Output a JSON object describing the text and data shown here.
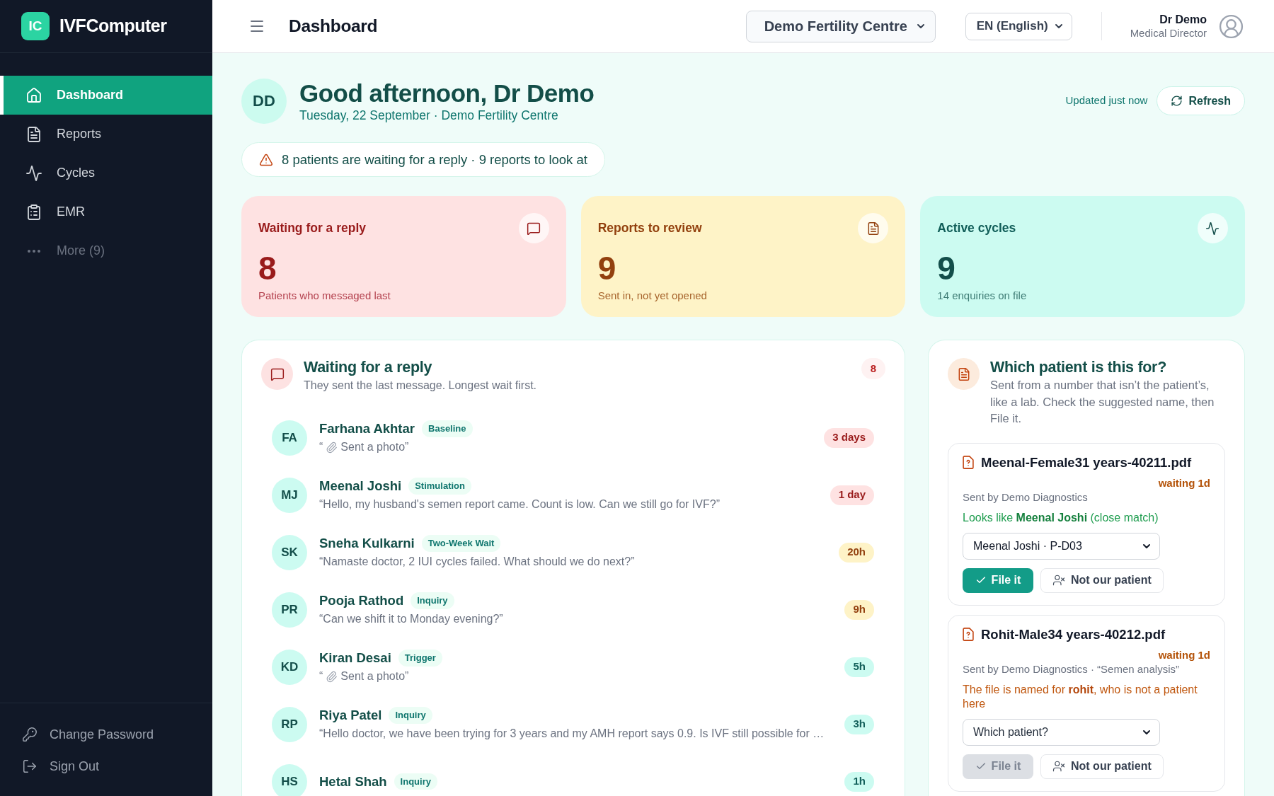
{
  "sidebar": {
    "logo_mark": "IC",
    "brand": "IVFComputer",
    "items": [
      {
        "label": "Dashboard",
        "kind": "page",
        "selected": true
      },
      {
        "label": "Reports",
        "kind": "page",
        "selected": false
      },
      {
        "label": "Cycles",
        "kind": "page",
        "selected": false
      },
      {
        "label": "EMR",
        "kind": "page",
        "selected": false
      },
      {
        "label": "More (9)",
        "kind": "more",
        "selected": false
      }
    ],
    "footer_items": [
      {
        "label": "Change Password"
      },
      {
        "label": "Sign Out"
      }
    ]
  },
  "header": {
    "title": "Dashboard",
    "centre_select": {
      "value": "Demo Fertility Centre"
    },
    "language_select": {
      "value": "EN (English)"
    },
    "user": {
      "name": "Dr Demo",
      "role": "Medical Director"
    }
  },
  "greeting": {
    "initials": "DD",
    "title": "Good afternoon, Dr Demo",
    "subtitle": "Tuesday, 22 September · Demo Fertility Centre",
    "updated": "Updated just now",
    "refresh_button": "Refresh"
  },
  "alert": {
    "text": "8 patients are waiting for a reply · 9 reports to look at"
  },
  "stats": [
    {
      "title": "Waiting for a reply",
      "value": "8",
      "note": "Patients who messaged last",
      "color": "#fee2e2"
    },
    {
      "title": "Reports to review",
      "value": "9",
      "note": "Sent in, not yet opened",
      "color": "#fef3c7"
    },
    {
      "title": "Active cycles",
      "value": "9",
      "note": "14 enquiries on file",
      "color": "#ccfbf1"
    }
  ],
  "waiting": {
    "title": "Waiting for a reply",
    "subtitle": "They sent the last message. Longest wait first.",
    "count": "8",
    "rows": [
      {
        "initials": "FA",
        "name": "Farhana Akhtar",
        "stage": "Baseline",
        "kind": "photo",
        "quote_open": "“",
        "message": "Sent a photo”",
        "age": "3 days",
        "color": "#fee2e2"
      },
      {
        "initials": "MJ",
        "name": "Meenal Joshi",
        "stage": "Stimulation",
        "kind": "text",
        "message": "“Hello, my husband's semen report came. Count is low. Can we still go for IVF?”",
        "age": "1 day",
        "color": "#fee2e2"
      },
      {
        "initials": "SK",
        "name": "Sneha Kulkarni",
        "stage": "Two-Week Wait",
        "kind": "text",
        "message": "“Namaste doctor, 2 IUI cycles failed. What should we do next?”",
        "age": "20h",
        "color": "#fef3c7"
      },
      {
        "initials": "PR",
        "name": "Pooja Rathod",
        "stage": "Inquiry",
        "kind": "text",
        "message": "“Can we shift it to Monday evening?”",
        "age": "9h",
        "color": "#fef3c7"
      },
      {
        "initials": "KD",
        "name": "Kiran Desai",
        "stage": "Trigger",
        "kind": "photo",
        "quote_open": "“",
        "message": "Sent a photo”",
        "age": "5h",
        "color": "#ccfbf1"
      },
      {
        "initials": "RP",
        "name": "Riya Patel",
        "stage": "Inquiry",
        "kind": "text",
        "message": "“Hello doctor, we have been trying for 3 years and my AMH report says 0.9. Is IVF still possible for …",
        "age": "3h",
        "color": "#ccfbf1"
      },
      {
        "initials": "HS",
        "name": "Hetal Shah",
        "stage": "Inquiry",
        "kind": "text",
        "age": "1h",
        "color": "#ccfbf1"
      }
    ]
  },
  "reports": {
    "title": "Which patient is this for?",
    "description": "Sent from a number that isn’t the patient’s, like a lab. Check the suggested name, then File it.",
    "files": [
      {
        "filename": "Meenal-Female31 years-40211.pdf",
        "age": "waiting 1d",
        "sender": "Sent by Demo Diagnostics",
        "kind": "matched",
        "note": "Looks like **Meenal Joshi** (close match)",
        "select": {
          "value": "Meenal Joshi · P-D03"
        },
        "file_button": {
          "label": "File it",
          "disabled": false
        },
        "reject_button": "Not our patient"
      },
      {
        "filename": "Rohit-Male34 years-40212.pdf",
        "age": "waiting 1d",
        "sender": "Sent by Demo Diagnostics · “Semen analysis”",
        "kind": "unmatched",
        "note": "The file is named for **rohit**, who is not a patient here",
        "select": {
          "placeholder": "Which patient?"
        },
        "file_button": {
          "label": "File it",
          "disabled": true
        },
        "reject_button": "Not our patient"
      }
    ]
  }
}
